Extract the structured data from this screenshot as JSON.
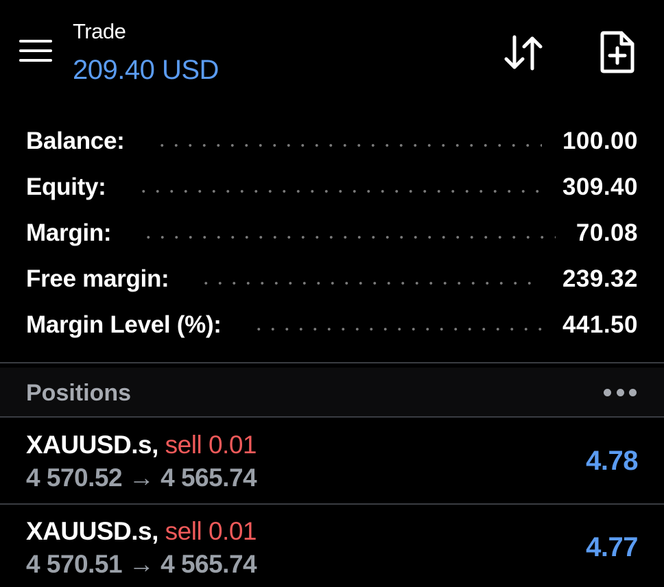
{
  "header": {
    "title": "Trade",
    "equity_display": "209.40 USD",
    "accent_color": "#5b9cf2"
  },
  "account": {
    "rows": [
      {
        "label": "Balance:",
        "value": "100.00"
      },
      {
        "label": "Equity:",
        "value": "309.40"
      },
      {
        "label": "Margin:",
        "value": "70.08"
      },
      {
        "label": "Free margin:",
        "value": "239.32"
      },
      {
        "label": "Margin Level (%):",
        "value": "441.50"
      }
    ]
  },
  "positions": {
    "title": "Positions",
    "items": [
      {
        "symbol": "XAUUSD.s,",
        "side": "sell 0.01",
        "open_price": "4 570.52",
        "arrow": "→",
        "current_price": "4 565.74",
        "profit": "4.78"
      },
      {
        "symbol": "XAUUSD.s,",
        "side": "sell 0.01",
        "open_price": "4 570.51",
        "arrow": "→",
        "current_price": "4 565.74",
        "profit": "4.77"
      }
    ]
  },
  "icons": {
    "menu": "hamburger-menu-icon",
    "sort": "sort-arrows-icon",
    "new_order": "add-document-icon",
    "more": "more-horizontal-icon"
  },
  "colors": {
    "sell": "#f05a5a",
    "profit": "#5b9cf2",
    "muted": "#9aa0a8"
  }
}
